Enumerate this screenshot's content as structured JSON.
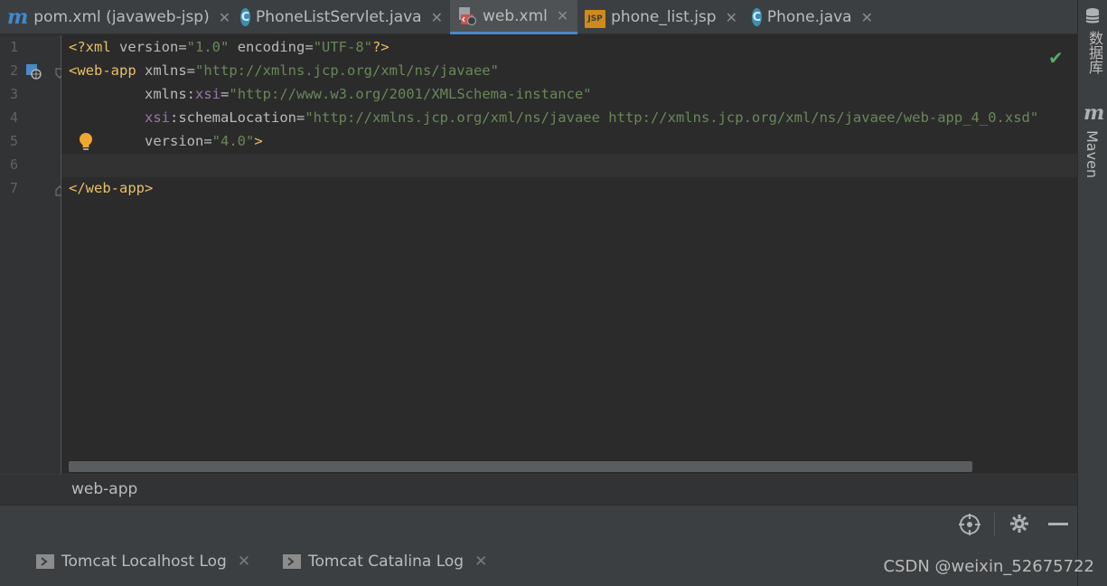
{
  "tabs": [
    {
      "label": "pom.xml (javaweb-jsp)",
      "icon": "maven-icon",
      "active": false
    },
    {
      "label": "PhoneListServlet.java",
      "icon": "java-class-icon",
      "active": false
    },
    {
      "label": "web.xml",
      "icon": "web-xml-icon",
      "active": true
    },
    {
      "label": "phone_list.jsp",
      "icon": "jsp-icon",
      "active": false
    },
    {
      "label": "Phone.java",
      "icon": "java-class-icon",
      "active": false
    }
  ],
  "icons": {
    "class_letter": "C",
    "maven_letter": "m",
    "jsp_text": "JSP",
    "close": "✕"
  },
  "line_numbers": [
    "1",
    "2",
    "3",
    "4",
    "5",
    "6",
    "7"
  ],
  "code": {
    "l1": {
      "p1": "<?xml ",
      "a1": "version",
      "eq1": "=",
      "v1": "\"1.0\"",
      "sp": " ",
      "a2": "encoding",
      "eq2": "=",
      "v2": "\"UTF-8\"",
      "p2": "?>"
    },
    "l2": {
      "t": "<web-app",
      "sp": " ",
      "a": "xmlns",
      "eq": "=",
      "v": "\"http://xmlns.jcp.org/xml/ns/javaee\""
    },
    "l3": {
      "indent": "         ",
      "a": "xmlns",
      "colon": ":",
      "ns": "xsi",
      "eq": "=",
      "v": "\"http://www.w3.org/2001/XMLSchema-instance\""
    },
    "l4": {
      "indent": "         ",
      "ns": "xsi",
      "colon": ":",
      "a": "schemaLocation",
      "eq": "=",
      "v": "\"http://xmlns.jcp.org/xml/ns/javaee http://xmlns.jcp.org/xml/ns/javaee/web-app_4_0.xsd\""
    },
    "l5": {
      "indent": "         ",
      "a": "version",
      "eq": "=",
      "v": "\"4.0\"",
      "t": ">"
    },
    "l7": {
      "t": "</web-app>"
    }
  },
  "breadcrumb": "web-app",
  "bottom_tabs": [
    {
      "label": "Tomcat Localhost Log"
    },
    {
      "label": "Tomcat Catalina Log"
    }
  ],
  "right_sidebar": {
    "database": "数据库",
    "maven": "Maven"
  },
  "watermark": "CSDN @weixin_52675722",
  "colors": {
    "tag": "#e8bf6a",
    "attribute": "#bababa",
    "namespace": "#9876aa",
    "value": "#6a8759",
    "accent": "#4a88c7"
  }
}
